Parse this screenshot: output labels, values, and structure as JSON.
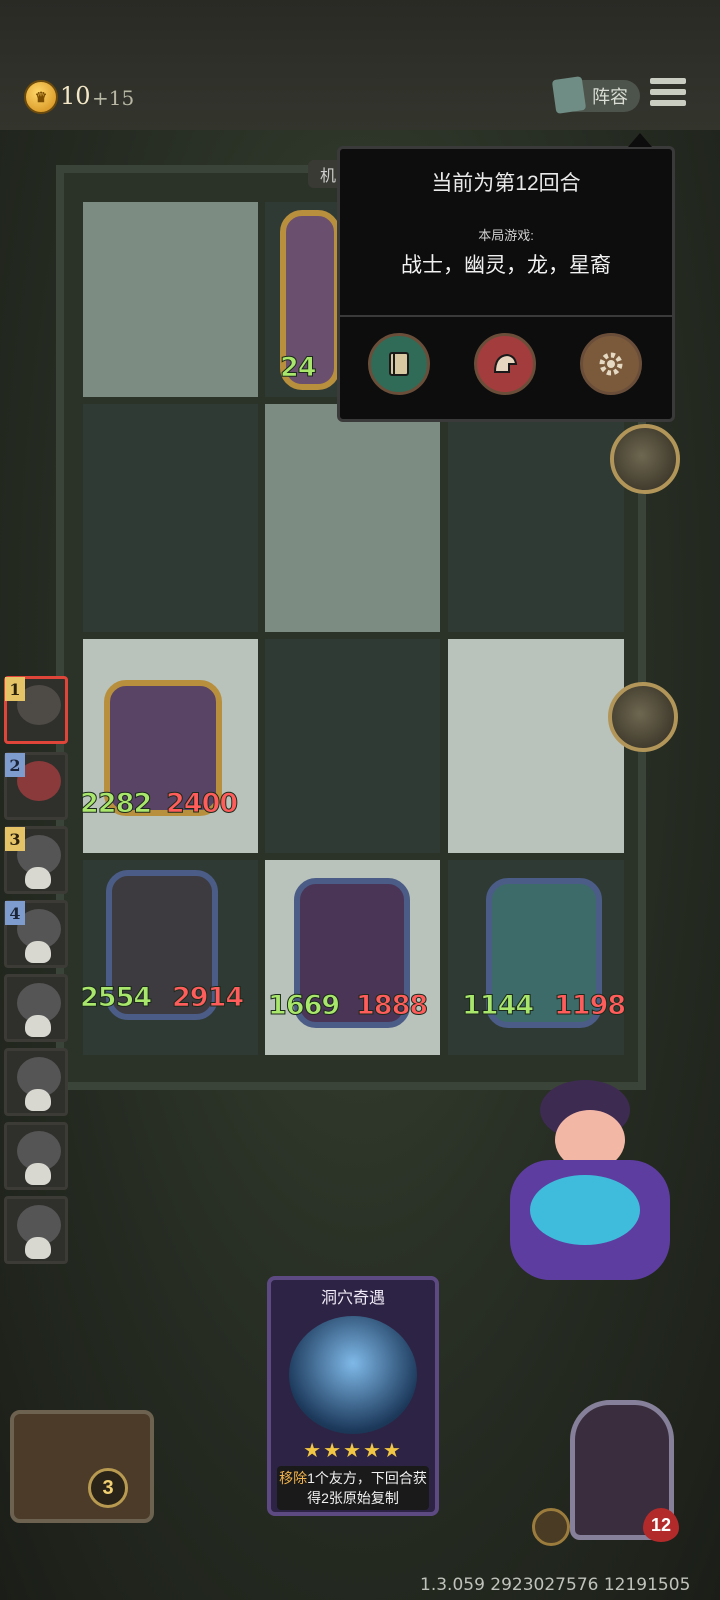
{
  "header": {
    "gold": "10",
    "gold_income": "+15",
    "lineup_label": "阵容",
    "menu_icon": "hamburger-menu-icon"
  },
  "board": {
    "machine_tab": "机",
    "units": [
      {
        "atk": "24",
        "hp": ""
      },
      {
        "atk": "2282",
        "hp": "2400"
      },
      {
        "atk": "2554",
        "hp": "2914"
      },
      {
        "atk": "1669",
        "hp": "1888"
      },
      {
        "atk": "1144",
        "hp": "1198"
      }
    ]
  },
  "popup": {
    "round_text": "当前为第12回合",
    "this_game_label": "本局游戏:",
    "tribes": "战士，幽灵，龙，星裔",
    "buttons": [
      "book-icon",
      "helmet-icon",
      "settings-gear-icon"
    ]
  },
  "roster": {
    "slots": [
      "1",
      "2",
      "3",
      "4"
    ]
  },
  "card": {
    "title": "洞穴奇遇",
    "stars": "★★★★★",
    "desc_highlight": "移除",
    "desc_rest": "1个友方，下回合获得2张原始复制"
  },
  "chest": {
    "count": "3"
  },
  "hero": {
    "hp": "12"
  },
  "footer": {
    "version": "1.3.059 2923027576 12191505"
  }
}
